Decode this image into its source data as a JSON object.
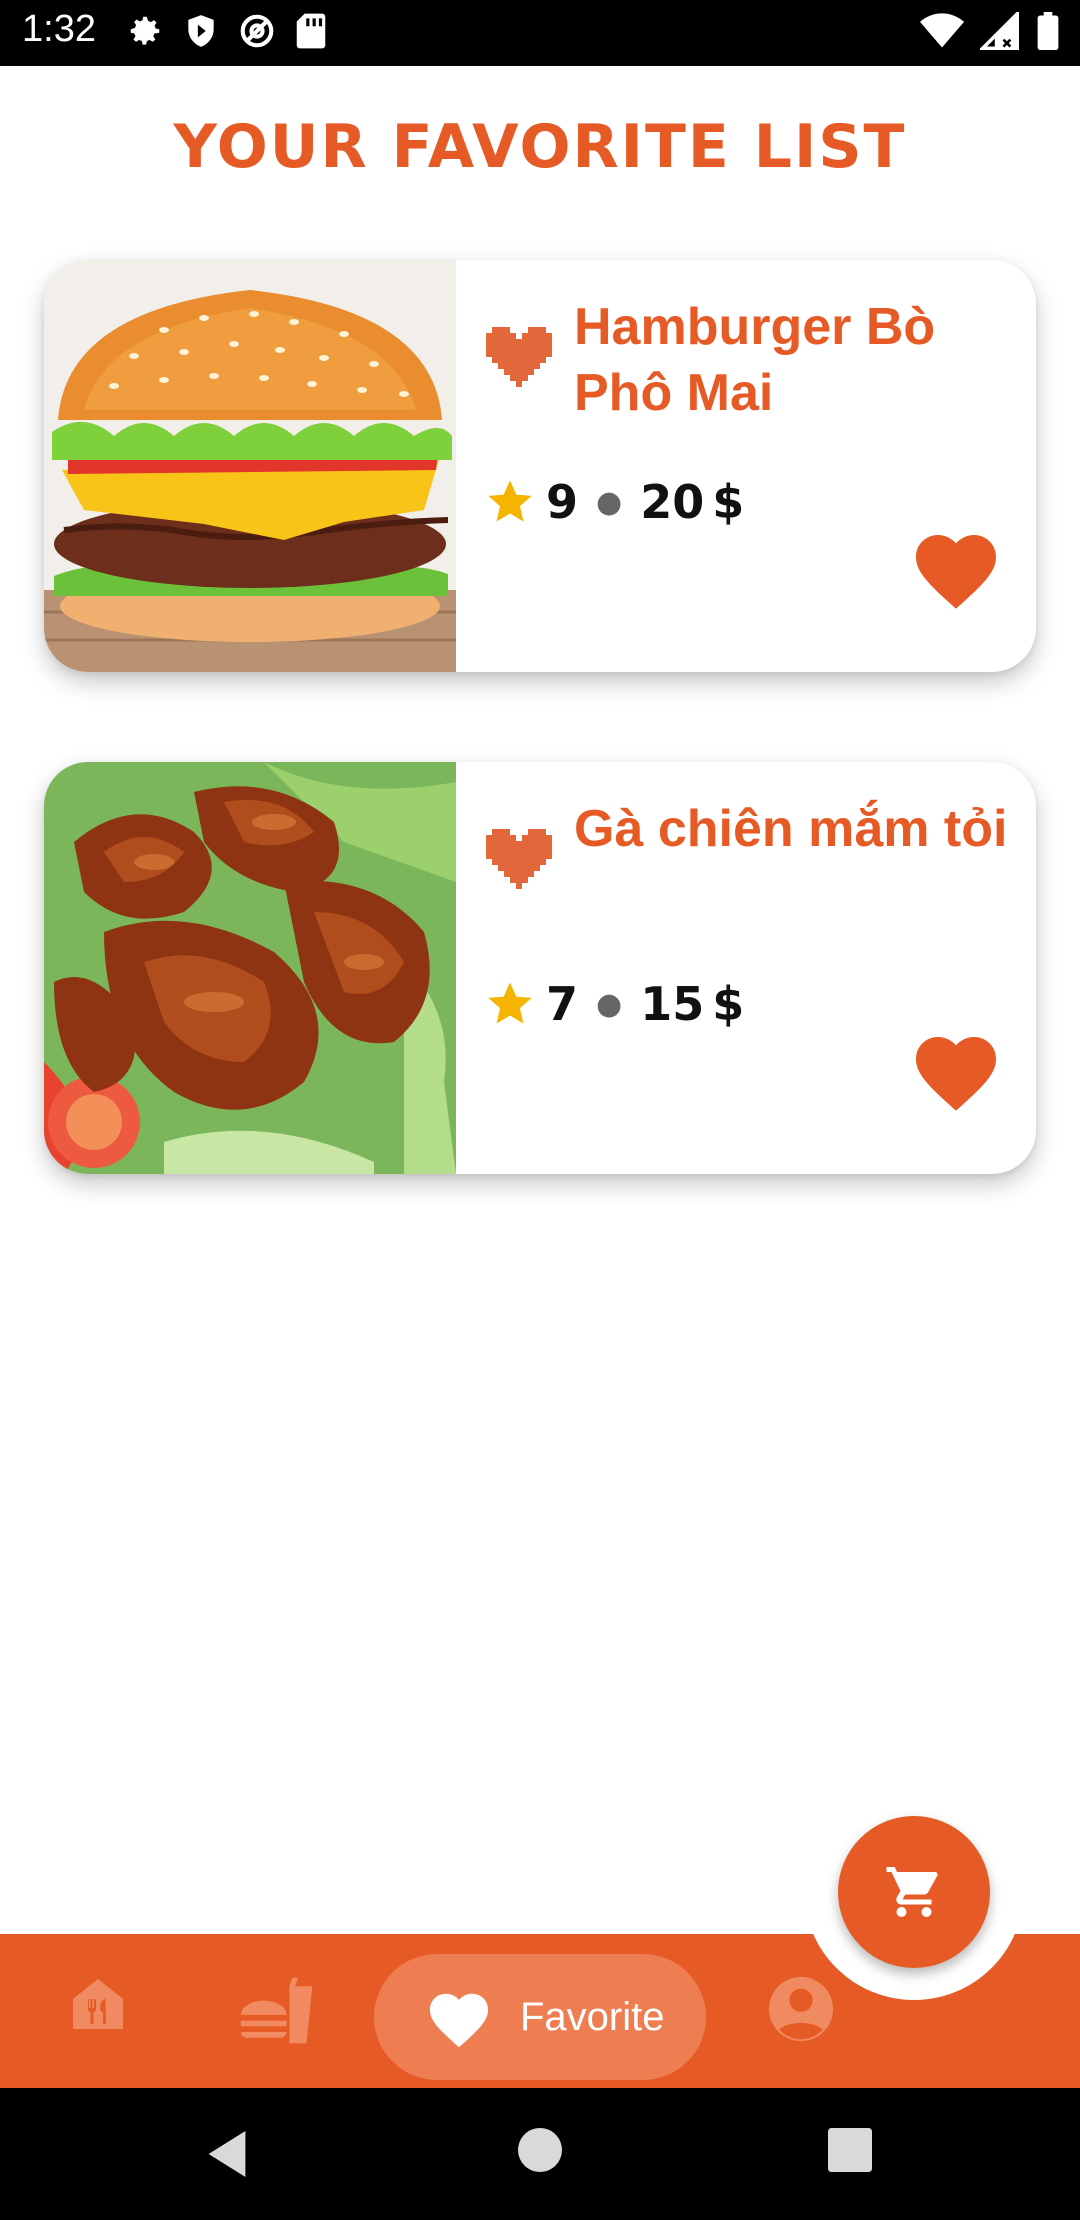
{
  "status_bar": {
    "time": "1:32",
    "left_icons": [
      "settings-icon",
      "shield-icon",
      "at-sign-icon",
      "sd-card-icon"
    ],
    "right_icons": [
      "wifi-icon",
      "signal-icon",
      "battery-icon"
    ]
  },
  "page": {
    "title": "YOUR FAVORITE LIST"
  },
  "favorites": [
    {
      "name": "Hamburger Bò Phô Mai",
      "rating": "9",
      "price": "20",
      "currency": "$",
      "image": "hamburger-photo"
    },
    {
      "name": "Gà chiên mắm tỏi",
      "rating": "7",
      "price": "15",
      "currency": "$",
      "image": "fried-chicken-wings-photo"
    }
  ],
  "fab": {
    "icon": "cart-icon"
  },
  "bottom_nav": {
    "items": [
      {
        "id": "home",
        "icon": "restaurant-home-icon",
        "active": false
      },
      {
        "id": "menu",
        "icon": "fast-food-icon",
        "active": false
      },
      {
        "id": "favorite",
        "icon": "heart-icon",
        "label": "Favorite",
        "active": true
      },
      {
        "id": "profile",
        "icon": "account-icon",
        "active": false
      }
    ]
  },
  "colors": {
    "accent": "#e65a25",
    "accent_light": "#ee7d52",
    "star": "#f5b400",
    "text_dark": "#111111",
    "background": "#ffffff"
  }
}
